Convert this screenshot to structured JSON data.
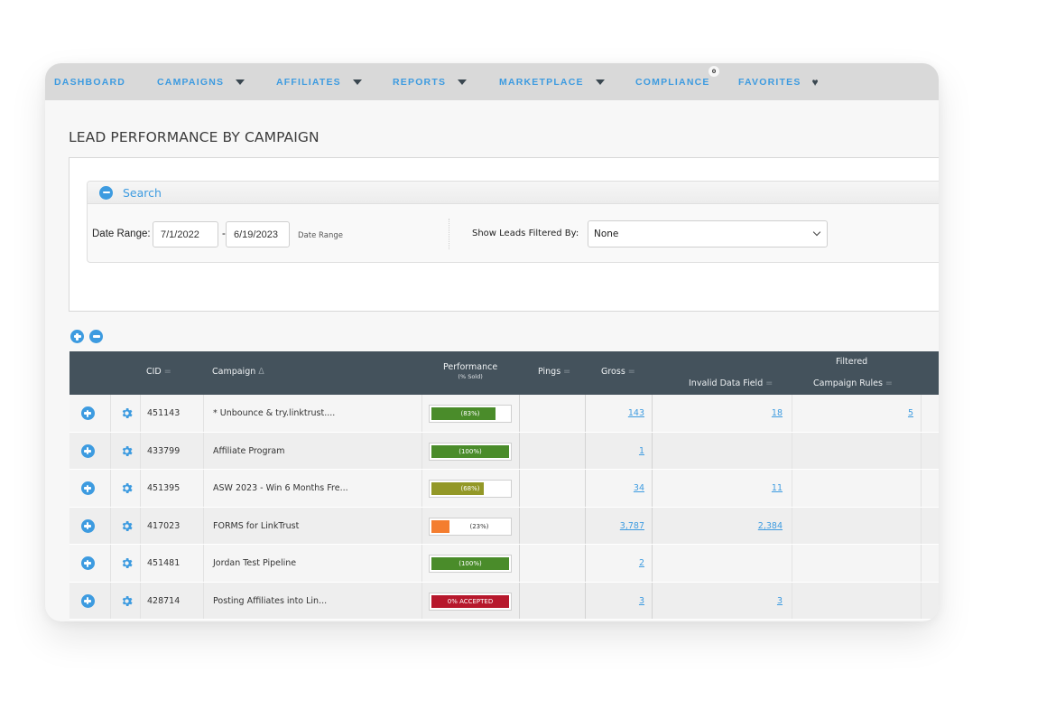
{
  "nav": {
    "items": [
      {
        "label": "DASHBOARD",
        "dropdown": false
      },
      {
        "label": "CAMPAIGNS",
        "dropdown": true
      },
      {
        "label": "AFFILIATES",
        "dropdown": true
      },
      {
        "label": "REPORTS",
        "dropdown": true
      },
      {
        "label": "MARKETPLACE",
        "dropdown": true
      },
      {
        "label": "COMPLIANCE",
        "dropdown": false,
        "badge": "0"
      },
      {
        "label": "FAVORITES",
        "icon": "heart-icon"
      }
    ]
  },
  "page": {
    "title": "LEAD PERFORMANCE BY CAMPAIGN"
  },
  "search": {
    "header_label": "Search",
    "header_icon": "minus-circle-icon",
    "date_range_label": "Date Range:",
    "start_date": "7/1/2022",
    "separator": "-",
    "end_date": "6/19/2023",
    "date_range_hint": "Date Range",
    "filter_label": "Show Leads Filtered By:",
    "filter_selected": "None"
  },
  "controls": {
    "expand_all_icon": "plus-circle-icon",
    "collapse_all_icon": "minus-circle-icon"
  },
  "colors": {
    "accent": "#3d9be0",
    "header_bg": "#44525c",
    "perf_green": "#4a8c2a",
    "perf_olive": "#939827",
    "perf_orange": "#f47d2f",
    "perf_red": "#b7182c"
  },
  "table": {
    "columns": {
      "cid": "CID",
      "campaign": "Campaign",
      "performance": "Performance",
      "performance_sub": "(% Sold)",
      "pings": "Pings",
      "gross": "Gross",
      "filtered_group": "Filtered",
      "invalid_data_field": "Invalid Data Field",
      "campaign_rules": "Campaign Rules",
      "sort_neutral": "=",
      "sort_asc": "Δ"
    },
    "rows": [
      {
        "cid": "451143",
        "campaign": "* Unbounce & try.linktrust....",
        "perf_label": "(83%)",
        "perf_pct": 83,
        "perf_color": "#4a8c2a",
        "pings": "",
        "gross": "143",
        "invalid": "18",
        "rules": "5"
      },
      {
        "cid": "433799",
        "campaign": "Affiliate Program",
        "perf_label": "(100%)",
        "perf_pct": 100,
        "perf_color": "#4a8c2a",
        "pings": "",
        "gross": "1",
        "invalid": "",
        "rules": ""
      },
      {
        "cid": "451395",
        "campaign": "ASW 2023 - Win 6 Months Fre...",
        "perf_label": "(68%)",
        "perf_pct": 68,
        "perf_color": "#939827",
        "pings": "",
        "gross": "34",
        "invalid": "11",
        "rules": ""
      },
      {
        "cid": "417023",
        "campaign": "FORMS for LinkTrust",
        "perf_label": "(23%)",
        "perf_pct": 23,
        "perf_color": "#f47d2f",
        "pings": "",
        "gross": "3,787",
        "invalid": "2,384",
        "rules": ""
      },
      {
        "cid": "451481",
        "campaign": "Jordan Test Pipeline",
        "perf_label": "(100%)",
        "perf_pct": 100,
        "perf_color": "#4a8c2a",
        "pings": "",
        "gross": "2",
        "invalid": "",
        "rules": ""
      },
      {
        "cid": "428714",
        "campaign": "Posting Affiliates into Lin...",
        "perf_label": "0% ACCEPTED",
        "perf_pct": 100,
        "perf_color": "#b7182c",
        "pings": "",
        "gross": "3",
        "invalid": "3",
        "rules": ""
      }
    ]
  }
}
